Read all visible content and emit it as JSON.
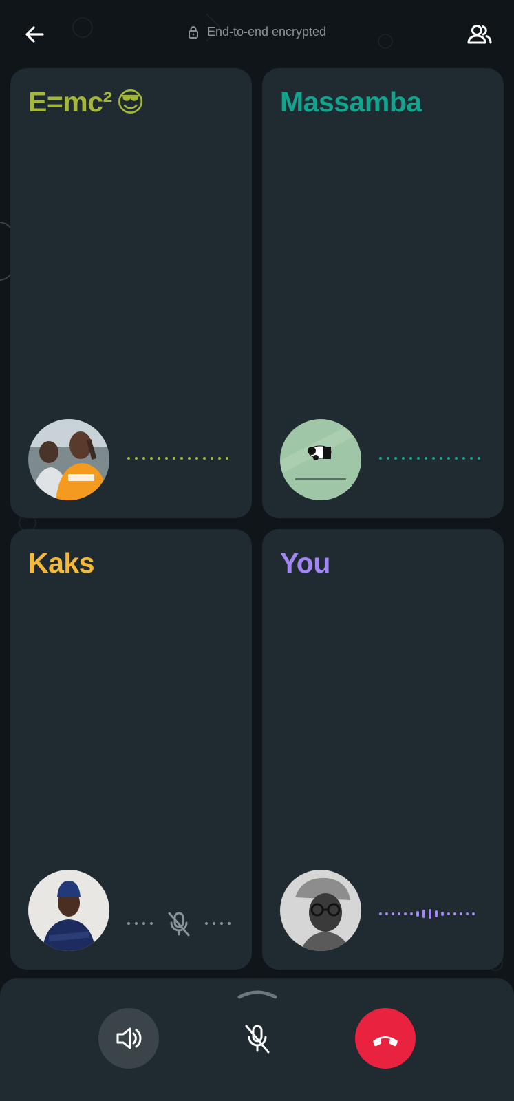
{
  "header": {
    "encryption_text": "End-to-end encrypted",
    "back_icon": "arrow-left-icon",
    "lock_icon": "lock-icon",
    "participants_icon": "participants-icon"
  },
  "participants": [
    {
      "name": "E=mc²",
      "emoji": "😎",
      "color": "#a5b73a",
      "muted": false,
      "avatar": "photo-orange-shirt"
    },
    {
      "name": "Massamba",
      "color": "#11a58f",
      "muted": false,
      "avatar": "panda-graphic"
    },
    {
      "name": "Kaks",
      "color": "#f5b93a",
      "muted": true,
      "avatar": "photo-blue-beanie"
    },
    {
      "name": "You",
      "color": "#a287f4",
      "muted": false,
      "avatar": "photo-grayscale-glasses"
    }
  ],
  "controls": {
    "speaker_icon": "speaker-icon",
    "mute_icon": "mic-off-icon",
    "end_call_icon": "end-call-icon",
    "expand_icon": "chevron-up-icon"
  },
  "colors": {
    "background": "#0f1519",
    "tile": "#1f2a31",
    "end_call": "#e8223f",
    "muted_grey": "#8a9399"
  }
}
